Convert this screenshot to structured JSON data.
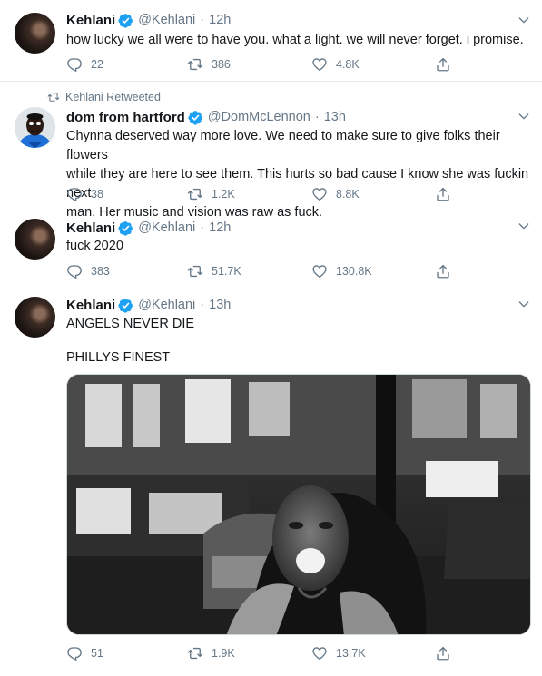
{
  "colors": {
    "accent": "#1da1f2",
    "muted": "#657786",
    "text": "#14171a",
    "divider": "#e6ecf0"
  },
  "tweets": [
    {
      "name": "Kehlani",
      "handle": "@Kehlani",
      "time": "12h",
      "lines": [
        "how lucky we all were to have you. what a light. we will never forget. i promise."
      ],
      "replies": "22",
      "retweets": "386",
      "likes": "4.8K"
    },
    {
      "retweeted_by": "Kehlani Retweeted",
      "name": "dom from hartford",
      "handle": "@DomMcLennon",
      "time": "13h",
      "lines": [
        "Chynna deserved way more love. We need to make sure to give folks their flowers",
        "while they are here to see them. This hurts so bad cause I know she was fuckin next",
        "man. Her music and vision was raw as fuck."
      ],
      "replies": "38",
      "retweets": "1.2K",
      "likes": "8.8K"
    },
    {
      "name": "Kehlani",
      "handle": "@Kehlani",
      "time": "12h",
      "lines": [
        "fuck 2020"
      ],
      "replies": "383",
      "retweets": "51.7K",
      "likes": "130.8K"
    },
    {
      "name": "Kehlani",
      "handle": "@Kehlani",
      "time": "13h",
      "lines": [
        "ANGELS NEVER DIE",
        "PHILLYS FINEST"
      ],
      "replies": "51",
      "retweets": "1.9K",
      "likes": "13.7K"
    }
  ],
  "icons": {
    "reply": "reply-icon",
    "retweet": "retweet-icon",
    "like": "heart-icon",
    "share": "share-icon",
    "caret": "chevron-down-icon",
    "verified": "verified-badge-icon"
  }
}
